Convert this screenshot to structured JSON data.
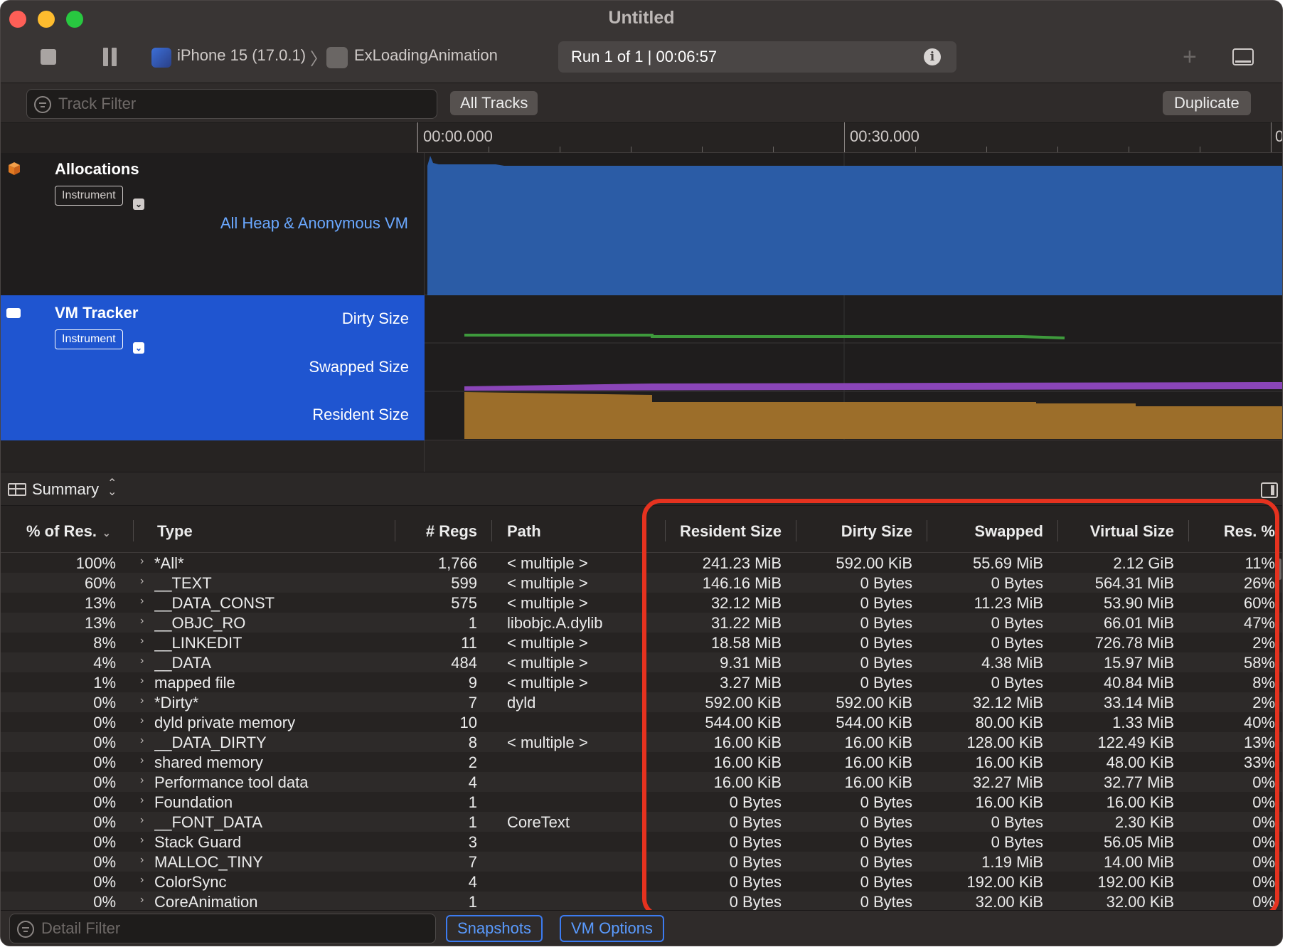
{
  "window": {
    "title": "Untitled"
  },
  "toolbar": {
    "device": "iPhone 15 (17.0.1)",
    "separator": "〉",
    "app": "ExLoadingAnimation",
    "run_status": "Run 1 of 1  |  00:06:57",
    "info_icon": "i",
    "add_icon": "+"
  },
  "filter_bar": {
    "track_filter_placeholder": "Track Filter",
    "all_tracks_label": "All Tracks",
    "duplicate_label": "Duplicate"
  },
  "timeline": {
    "ruler_labels": [
      "00:00.000",
      "00:30.000",
      "0"
    ]
  },
  "tracks": {
    "allocations": {
      "name": "Allocations",
      "tag": "Instrument",
      "subtrack": "All Heap & Anonymous VM",
      "fill_color": "#2b5ca6"
    },
    "vm_tracker": {
      "name": "VM Tracker",
      "tag": "Instrument",
      "subtracks": [
        "Dirty Size",
        "Swapped Size",
        "Resident Size"
      ],
      "dirty_color": "#3e9a3c",
      "swapped_color": "#8a45b8",
      "resident_color": "#9c6e2a"
    }
  },
  "detail": {
    "view_label": "Summary",
    "chevron": "⌃⌄"
  },
  "table": {
    "columns": [
      "% of Res.",
      "Type",
      "# Regs",
      "Path",
      "Resident Size",
      "Dirty Size",
      "Swapped",
      "Virtual Size",
      "Res. %"
    ],
    "sort_chevron": "⌄",
    "rows": [
      [
        "100%",
        "*All*",
        "1,766",
        "< multiple >",
        "241.23 MiB",
        "592.00 KiB",
        "55.69 MiB",
        "2.12 GiB",
        "11%"
      ],
      [
        "60%",
        "__TEXT",
        "599",
        "< multiple >",
        "146.16 MiB",
        "0 Bytes",
        "0 Bytes",
        "564.31 MiB",
        "26%"
      ],
      [
        "13%",
        "__DATA_CONST",
        "575",
        "< multiple >",
        "32.12 MiB",
        "0 Bytes",
        "11.23 MiB",
        "53.90 MiB",
        "60%"
      ],
      [
        "13%",
        "__OBJC_RO",
        "1",
        "libobjc.A.dylib",
        "31.22 MiB",
        "0 Bytes",
        "0 Bytes",
        "66.01 MiB",
        "47%"
      ],
      [
        "8%",
        "__LINKEDIT",
        "11",
        "< multiple >",
        "18.58 MiB",
        "0 Bytes",
        "0 Bytes",
        "726.78 MiB",
        "2%"
      ],
      [
        "4%",
        "__DATA",
        "484",
        "< multiple >",
        "9.31 MiB",
        "0 Bytes",
        "4.38 MiB",
        "15.97 MiB",
        "58%"
      ],
      [
        "1%",
        "mapped file",
        "9",
        "< multiple >",
        "3.27 MiB",
        "0 Bytes",
        "0 Bytes",
        "40.84 MiB",
        "8%"
      ],
      [
        "0%",
        "*Dirty*",
        "7",
        "dyld",
        "592.00 KiB",
        "592.00 KiB",
        "32.12 MiB",
        "33.14 MiB",
        "2%"
      ],
      [
        "0%",
        "dyld private memory",
        "10",
        "",
        "544.00 KiB",
        "544.00 KiB",
        "80.00 KiB",
        "1.33 MiB",
        "40%"
      ],
      [
        "0%",
        "__DATA_DIRTY",
        "8",
        "< multiple >",
        "16.00 KiB",
        "16.00 KiB",
        "128.00 KiB",
        "122.49 KiB",
        "13%"
      ],
      [
        "0%",
        "shared memory",
        "2",
        "",
        "16.00 KiB",
        "16.00 KiB",
        "16.00 KiB",
        "48.00 KiB",
        "33%"
      ],
      [
        "0%",
        "Performance tool data",
        "4",
        "",
        "16.00 KiB",
        "16.00 KiB",
        "32.27 MiB",
        "32.77 MiB",
        "0%"
      ],
      [
        "0%",
        "Foundation",
        "1",
        "",
        "0 Bytes",
        "0 Bytes",
        "16.00 KiB",
        "16.00 KiB",
        "0%"
      ],
      [
        "0%",
        "__FONT_DATA",
        "1",
        "CoreText",
        "0 Bytes",
        "0 Bytes",
        "0 Bytes",
        "2.30 KiB",
        "0%"
      ],
      [
        "0%",
        "Stack Guard",
        "3",
        "",
        "0 Bytes",
        "0 Bytes",
        "0 Bytes",
        "56.05 MiB",
        "0%"
      ],
      [
        "0%",
        "MALLOC_TINY",
        "7",
        "",
        "0 Bytes",
        "0 Bytes",
        "1.19 MiB",
        "14.00 MiB",
        "0%"
      ],
      [
        "0%",
        "ColorSync",
        "4",
        "",
        "0 Bytes",
        "0 Bytes",
        "192.00 KiB",
        "192.00 KiB",
        "0%"
      ],
      [
        "0%",
        "CoreAnimation",
        "1",
        "",
        "0 Bytes",
        "0 Bytes",
        "32.00 KiB",
        "32.00 KiB",
        "0%"
      ]
    ]
  },
  "bottom_bar": {
    "detail_filter_placeholder": "Detail Filter",
    "snapshots_label": "Snapshots",
    "vm_options_label": "VM Options"
  },
  "colors": {
    "highlight": "#e5321f",
    "accent_blue": "#3c7bf0",
    "selected_track": "#1f55d0"
  }
}
